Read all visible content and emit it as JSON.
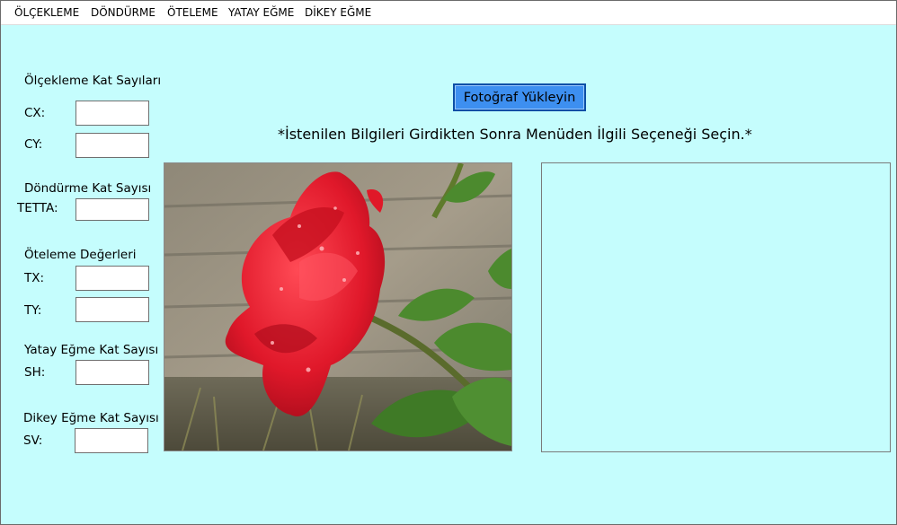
{
  "menu": {
    "items": [
      "ÖLÇEKLEME",
      "DÖNDÜRME",
      "ÖTELEME",
      "YATAY EĞME",
      "DİKEY EĞME"
    ]
  },
  "left_panel": {
    "scale_title": "Ölçekleme Kat Sayıları",
    "cx_label": "CX:",
    "cy_label": "CY:",
    "rotate_title": "Döndürme Kat Sayısı",
    "tetta_label": "TETTA:",
    "translate_title": "Öteleme Değerleri",
    "tx_label": "TX:",
    "ty_label": "TY:",
    "hshear_title": "Yatay Eğme Kat Sayısı",
    "sh_label": "SH:",
    "vshear_title": "Dikey Eğme Kat Sayısı",
    "sv_label": "SV:",
    "values": {
      "cx": "",
      "cy": "",
      "tetta": "",
      "tx": "",
      "ty": "",
      "sh": "",
      "sv": ""
    }
  },
  "main": {
    "upload_button": "Fotoğraf Yükleyin",
    "instruction": "*İstenilen Bilgileri Girdikten Sonra Menüden İlgili Seçeneği Seçin.*",
    "image_subject": "red-rose-photo"
  },
  "colors": {
    "background": "#c5fdfd",
    "button": "#3d8ff0",
    "button_border": "#0b4fa6"
  }
}
